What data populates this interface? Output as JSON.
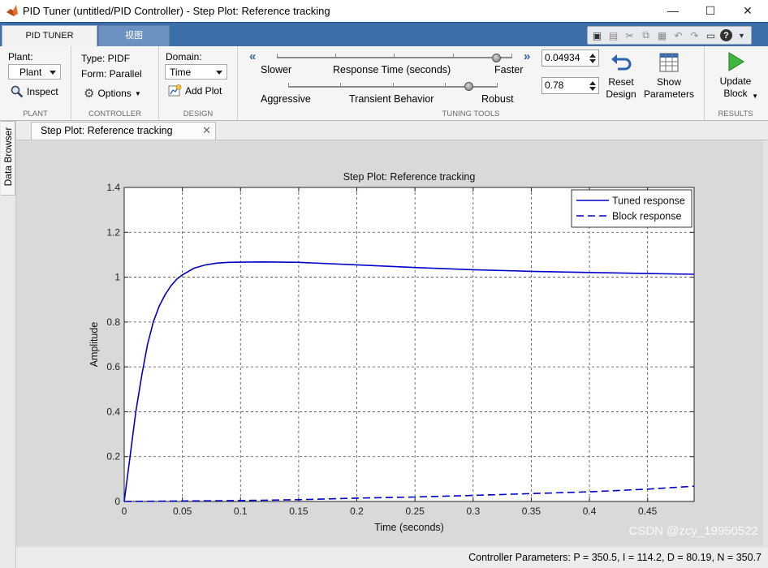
{
  "window": {
    "title": "PID Tuner (untitled/PID Controller) - Step Plot: Reference tracking",
    "controls": {
      "minimize": "—",
      "maximize": "☐",
      "close": "✕"
    }
  },
  "ribbon_tabs": [
    {
      "label": "PID TUNER",
      "active": true
    },
    {
      "label": "视图",
      "active": false
    }
  ],
  "quick_access": {
    "icons": [
      "layout-icon",
      "save-icon",
      "cut-icon",
      "copy-icon",
      "paste-icon",
      "undo-icon",
      "redo-icon",
      "window-icon",
      "help-icon"
    ]
  },
  "toolstrip": {
    "plant": {
      "label": "Plant:",
      "value": "Plant",
      "inspect": "Inspect",
      "section": "PLANT"
    },
    "controller": {
      "type": "Type: PIDF",
      "form": "Form: Parallel",
      "options": "Options",
      "section": "CONTROLLER"
    },
    "design": {
      "domain_label": "Domain:",
      "domain_value": "Time",
      "add_plot": "Add Plot",
      "section": "DESIGN"
    },
    "tuning": {
      "section": "TUNING TOOLS",
      "response_time": {
        "left": "Slower",
        "center": "Response Time (seconds)",
        "right": "Faster",
        "value": "0.04934",
        "level": 0.93
      },
      "transient": {
        "left": "Aggressive",
        "center": "Transient Behavior",
        "right": "Robust",
        "value": "0.78",
        "level": 0.86
      },
      "reset": "Reset\nDesign",
      "show": "Show\nParameters"
    },
    "results": {
      "update": "Update\nBlock",
      "section": "RESULTS"
    }
  },
  "side_panel": {
    "label": "Data Browser"
  },
  "document_tab": {
    "title": "Step Plot: Reference tracking",
    "close": "✕"
  },
  "status": {
    "controller_parameters": "Controller Parameters: P = 350.5, I = 114.2, D = 80.19, N = 350.7"
  },
  "watermark": "CSDN @zcy_19950522",
  "colors": {
    "series": "#0000cc",
    "ribbon_blue": "#3d6ea9",
    "plot_bg": "#ffffff",
    "frame_bg": "#d9d9d9"
  },
  "chart_data": {
    "type": "line",
    "title": "Step Plot: Reference tracking",
    "xlabel": "Time (seconds)",
    "ylabel": "Amplitude",
    "xlim": [
      0,
      0.49
    ],
    "ylim": [
      0,
      1.4
    ],
    "xticks": [
      0,
      0.05,
      0.1,
      0.15,
      0.2,
      0.25,
      0.3,
      0.35,
      0.4,
      0.45
    ],
    "xtick_labels": [
      "0",
      "0.05",
      "0.1",
      "0.15",
      "0.2",
      "0.25",
      "0.3",
      "0.35",
      "0.4",
      "0.45"
    ],
    "yticks": [
      0,
      0.2,
      0.4,
      0.6,
      0.8,
      1,
      1.2,
      1.4
    ],
    "ytick_labels": [
      "0",
      "0.2",
      "0.4",
      "0.6",
      "0.8",
      "1",
      "1.2",
      "1.4"
    ],
    "grid": true,
    "legend_position": "top-right",
    "series": [
      {
        "name": "Tuned response",
        "style": "solid",
        "x": [
          0,
          0.005,
          0.01,
          0.015,
          0.02,
          0.025,
          0.03,
          0.035,
          0.04,
          0.045,
          0.05,
          0.06,
          0.07,
          0.08,
          0.09,
          0.1,
          0.12,
          0.15,
          0.2,
          0.25,
          0.3,
          0.35,
          0.4,
          0.45,
          0.49
        ],
        "y": [
          0,
          0.2,
          0.4,
          0.56,
          0.7,
          0.8,
          0.87,
          0.92,
          0.96,
          0.99,
          1.01,
          1.04,
          1.055,
          1.063,
          1.066,
          1.067,
          1.068,
          1.066,
          1.055,
          1.043,
          1.033,
          1.026,
          1.021,
          1.016,
          1.013
        ]
      },
      {
        "name": "Block response",
        "style": "dashed",
        "x": [
          0,
          0.05,
          0.1,
          0.15,
          0.2,
          0.25,
          0.3,
          0.35,
          0.4,
          0.45,
          0.49
        ],
        "y": [
          0,
          0.002,
          0.004,
          0.008,
          0.015,
          0.02,
          0.027,
          0.035,
          0.043,
          0.055,
          0.068
        ]
      }
    ]
  }
}
